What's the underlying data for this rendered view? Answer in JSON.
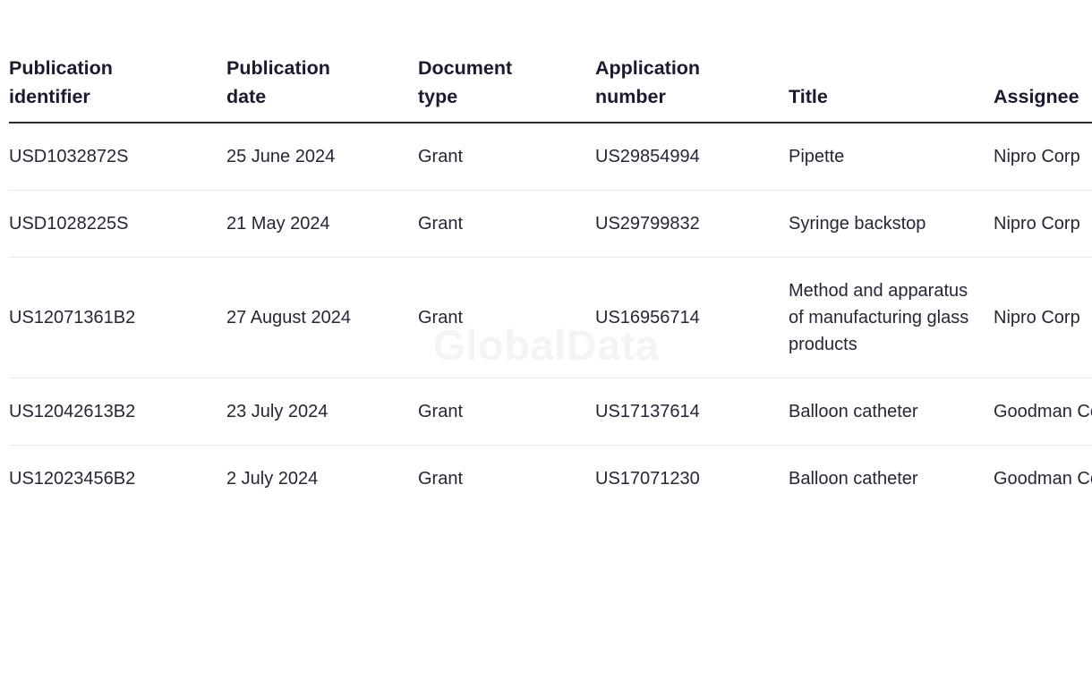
{
  "watermark": {
    "text": "GlobalData",
    "color": "#f4f4f6"
  },
  "theme": {
    "background": "#ffffff",
    "header_text": "#1b1b2f",
    "body_text": "#262637",
    "header_rule": "#2b2b33",
    "row_rule": "#e9e9ec"
  },
  "table": {
    "columns": [
      {
        "label": "Publication\nidentifier",
        "key": "publication_identifier"
      },
      {
        "label": "Publication\ndate",
        "key": "publication_date"
      },
      {
        "label": "Document\ntype",
        "key": "document_type"
      },
      {
        "label": "Application\nnumber",
        "key": "application_number"
      },
      {
        "label": "Title",
        "key": "title"
      },
      {
        "label": "Assignee",
        "key": "assignee"
      }
    ],
    "rows": [
      {
        "publication_identifier": "USD1032872S",
        "publication_date": "25 June 2024",
        "document_type": "Grant",
        "application_number": "US29854994",
        "title": "Pipette",
        "assignee": "Nipro Corp"
      },
      {
        "publication_identifier": "USD1028225S",
        "publication_date": "21 May 2024",
        "document_type": "Grant",
        "application_number": "US29799832",
        "title": "Syringe backstop",
        "assignee": "Nipro Corp"
      },
      {
        "publication_identifier": "US12071361B2",
        "publication_date": "27 August 2024",
        "document_type": "Grant",
        "application_number": "US16956714",
        "title": "Method and apparatus of manufacturing glass products",
        "assignee": "Nipro Corp"
      },
      {
        "publication_identifier": "US12042613B2",
        "publication_date": "23 July 2024",
        "document_type": "Grant",
        "application_number": "US17137614",
        "title": "Balloon catheter",
        "assignee": "Goodman Co Ltd"
      },
      {
        "publication_identifier": "US12023456B2",
        "publication_date": "2 July 2024",
        "document_type": "Grant",
        "application_number": "US17071230",
        "title": "Balloon catheter",
        "assignee": "Goodman Co Ltd"
      }
    ]
  }
}
